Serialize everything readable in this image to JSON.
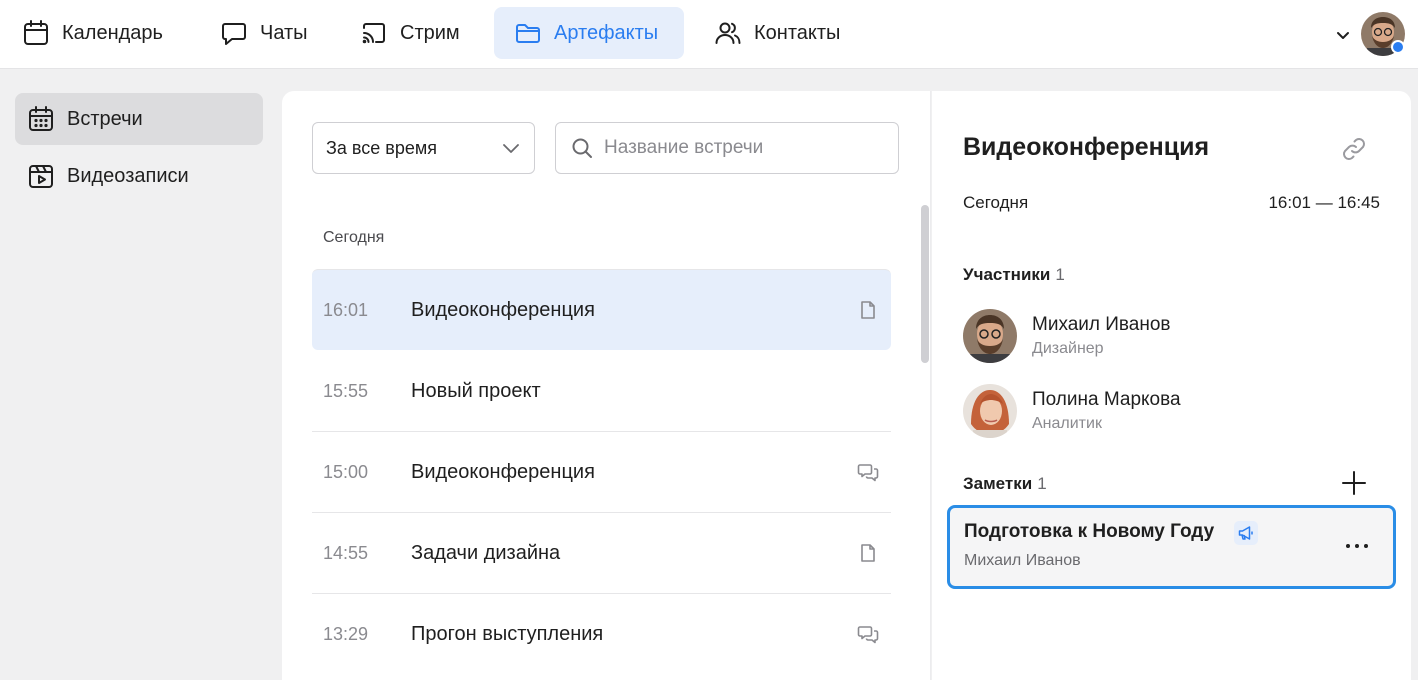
{
  "nav": {
    "items": [
      {
        "label": "Календарь",
        "icon": "calendar-icon"
      },
      {
        "label": "Чаты",
        "icon": "chat-icon"
      },
      {
        "label": "Стрим",
        "icon": "stream-icon"
      },
      {
        "label": "Артефакты",
        "icon": "folder-icon",
        "active": true
      },
      {
        "label": "Контакты",
        "icon": "contacts-icon"
      }
    ],
    "accent_color": "#2a7df0"
  },
  "sidebar": {
    "items": [
      {
        "label": "Встречи",
        "icon": "calendar-grid-icon",
        "active": true
      },
      {
        "label": "Видеозаписи",
        "icon": "video-recording-icon"
      }
    ]
  },
  "filters": {
    "period": "За все время",
    "search_placeholder": "Название встречи"
  },
  "list": {
    "group_label": "Сегодня",
    "meetings": [
      {
        "time": "16:01",
        "title": "Видеоконференция",
        "icon": "document-icon",
        "selected": true
      },
      {
        "time": "15:55",
        "title": "Новый проект",
        "icon": ""
      },
      {
        "time": "15:00",
        "title": "Видеоконференция",
        "icon": "chat-bubbles-icon"
      },
      {
        "time": "14:55",
        "title": "Задачи дизайна",
        "icon": "document-icon"
      },
      {
        "time": "13:29",
        "title": "Прогон выступления",
        "icon": "chat-bubbles-icon"
      }
    ]
  },
  "detail": {
    "title": "Видеоконференция",
    "date": "Сегодня",
    "time_range": "16:01 — 16:45",
    "participants_label": "Участники",
    "participants_count": "1",
    "participants": [
      {
        "name": "Михаил Иванов",
        "role": "Дизайнер"
      },
      {
        "name": "Полина Маркова",
        "role": "Аналитик"
      }
    ],
    "notes_label": "Заметки",
    "notes_count": "1",
    "notes": [
      {
        "title": "Подготовка к Новому Году",
        "author": "Михаил Иванов"
      }
    ]
  }
}
